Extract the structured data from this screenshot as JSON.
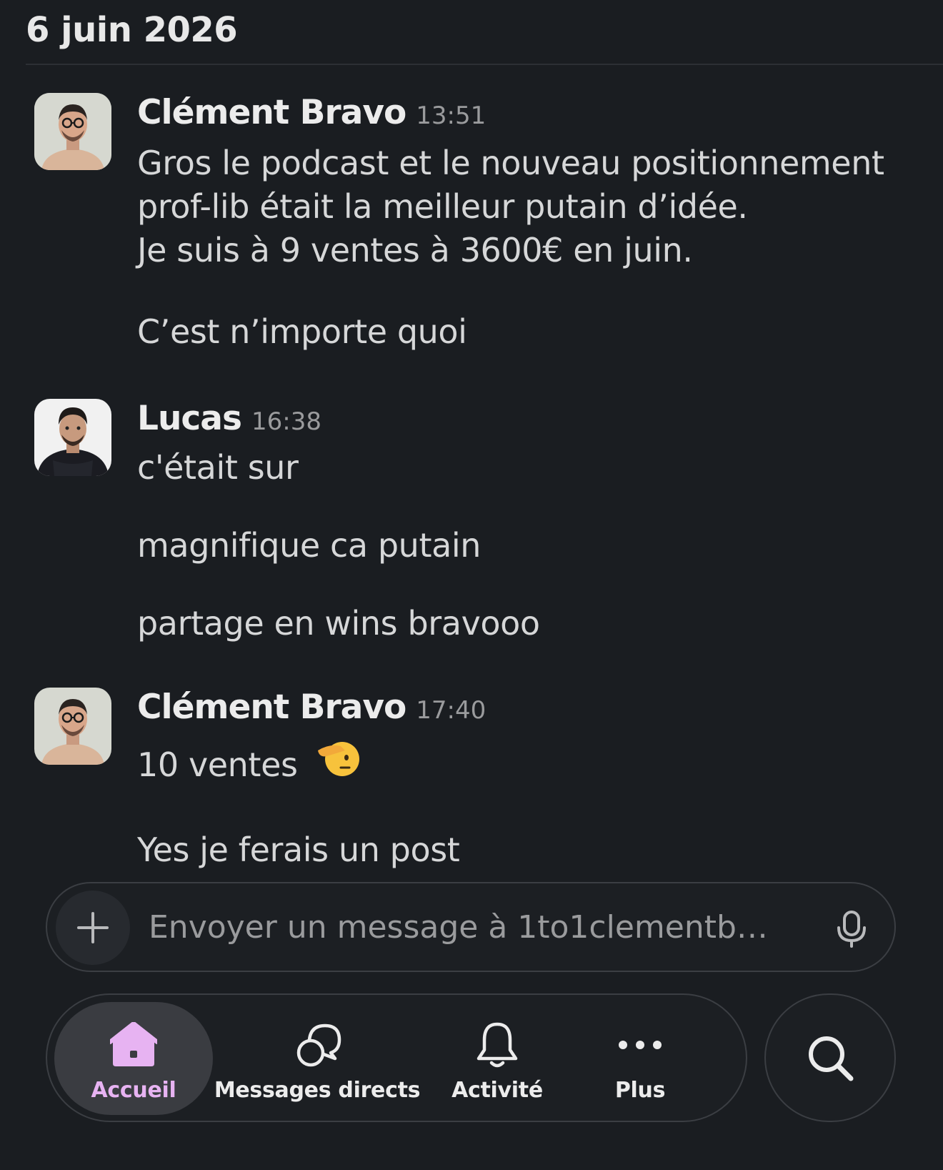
{
  "date_header": "6 juin 2026",
  "messages": [
    {
      "author": "Clément Bravo",
      "time": "13:51",
      "lines": [
        "Gros le podcast et le nouveau positionnement",
        "prof-lib était la meilleur putain d’idée.",
        "Je suis à 9 ventes à 3600€ en juin.",
        "C’est n’importe quoi"
      ]
    },
    {
      "author": "Lucas",
      "time": "16:38",
      "lines": [
        "c'était sur",
        "magnifique ca putain",
        "partage en wins bravooo"
      ]
    },
    {
      "author": "Clément Bravo",
      "time": "17:40",
      "lines": [
        "10 ventes",
        "Yes je ferais un post"
      ],
      "emoji": "saluting-face"
    }
  ],
  "composer": {
    "placeholder": "Envoyer un message à 1to1clementbra..."
  },
  "nav": {
    "items": [
      {
        "label": "Accueil",
        "icon": "home-icon",
        "active": true
      },
      {
        "label": "Messages directs",
        "icon": "direct-messages-icon",
        "active": false
      },
      {
        "label": "Activité",
        "icon": "bell-icon",
        "active": false
      },
      {
        "label": "Plus",
        "icon": "more-icon",
        "active": false
      }
    ],
    "search_icon": "search-icon"
  },
  "colors": {
    "background": "#1a1d21",
    "active_accent": "#e7b3f2",
    "timestamp": "#9a9b9d"
  }
}
